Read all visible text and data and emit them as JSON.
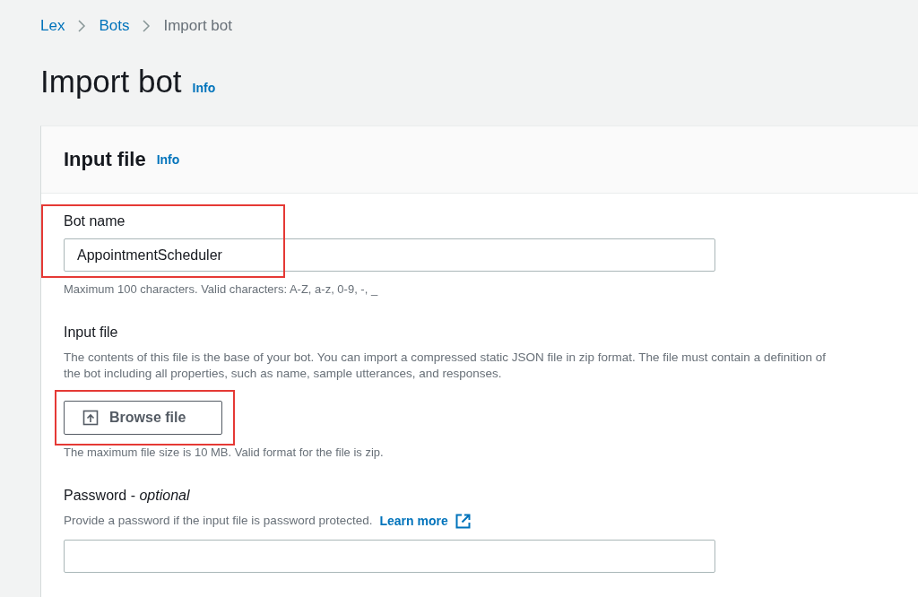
{
  "breadcrumb": [
    {
      "label": "Lex",
      "kind": "link"
    },
    {
      "label": "Bots",
      "kind": "link"
    },
    {
      "label": "Import bot",
      "kind": "current"
    }
  ],
  "page": {
    "title": "Import bot",
    "info": "Info"
  },
  "panel": {
    "title": "Input file",
    "info": "Info",
    "fields": [
      {
        "kind": "text",
        "label": "Bot name",
        "value": "AppointmentScheduler",
        "hint": "Maximum 100 characters. Valid characters: A-Z, a-z, 0-9, -, _",
        "highlighted": true
      },
      {
        "kind": "file",
        "label": "Input file",
        "description": "The contents of this file is the base of your bot. You can import a compressed static JSON file in zip format. The file must contain a definition of the bot including all properties, such as name, sample utterances, and responses.",
        "button": "Browse file",
        "hint": "The maximum file size is 10 MB. Valid format for the file is zip.",
        "highlighted": true
      },
      {
        "kind": "password",
        "label": "Password - *optional*",
        "description": "Provide a password if the input file is password protected.",
        "link": "Learn more"
      }
    ]
  }
}
